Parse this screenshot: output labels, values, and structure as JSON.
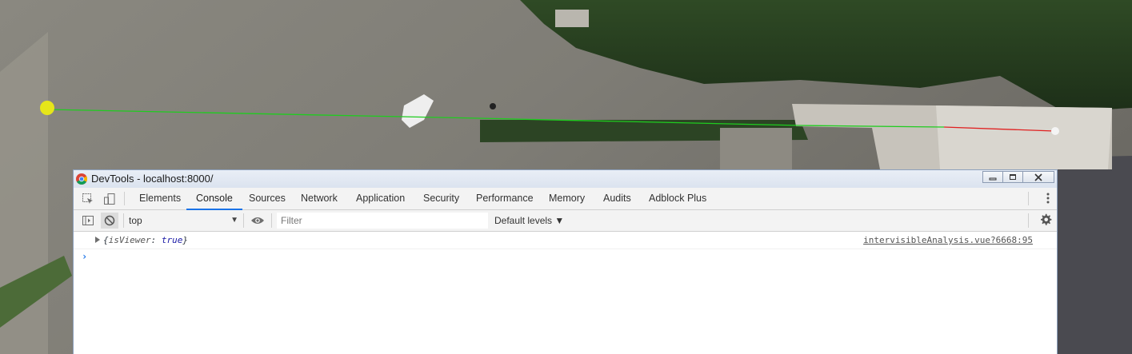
{
  "window": {
    "title": "DevTools - localhost:8000/"
  },
  "tabs": [
    {
      "label": "Elements"
    },
    {
      "label": "Console",
      "active": true
    },
    {
      "label": "Sources"
    },
    {
      "label": "Network"
    },
    {
      "label": "Application"
    },
    {
      "label": "Security"
    },
    {
      "label": "Performance"
    },
    {
      "label": "Memory"
    },
    {
      "label": "Audits"
    },
    {
      "label": "Adblock Plus"
    }
  ],
  "console_toolbar": {
    "context": "top",
    "filter_placeholder": "Filter",
    "levels": "Default levels ▼"
  },
  "messages": [
    {
      "open": "{",
      "key": "isViewer",
      "colon": ": ",
      "value": "true",
      "close": "}",
      "source": "intervisibleAnalysis.vue?6668:95"
    }
  ],
  "prompt_symbol": "›",
  "colors": {
    "accent": "#1a73e8",
    "visible_line": "#1fcc1f",
    "blocked_line": "#e02020",
    "start_marker": "#e6e61a"
  },
  "icons": [
    "chrome-icon",
    "minimize-icon",
    "maximize-icon",
    "close-icon",
    "inspect-element-icon",
    "device-toolbar-icon",
    "more-options-icon",
    "sidebar-toggle-icon",
    "clear-console-icon",
    "eye-icon",
    "settings-gear-icon"
  ]
}
